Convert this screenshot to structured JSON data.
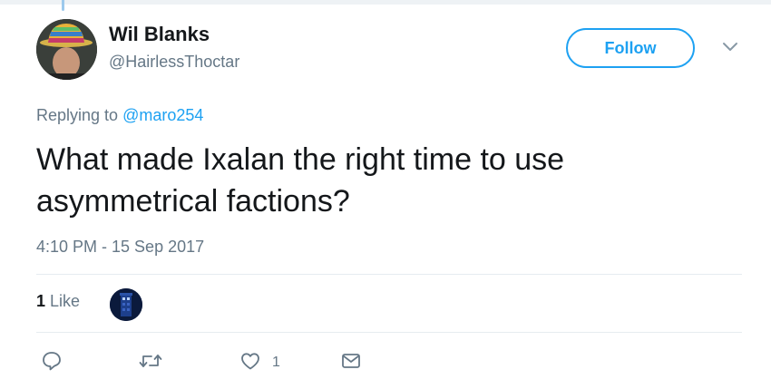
{
  "author": {
    "name": "Wil Blanks",
    "handle": "@HairlessThoctar"
  },
  "follow_label": "Follow",
  "reply_context": {
    "prefix": "Replying to",
    "mention": "@maro254"
  },
  "tweet": {
    "text": "What made Ixalan the right time to use asymmetrical factions?",
    "timestamp": "4:10 PM - 15 Sep 2017"
  },
  "engagement": {
    "like_count": "1",
    "like_label": "Like"
  },
  "actions": {
    "like_count": "1"
  },
  "colors": {
    "accent": "#1da1f2",
    "muted": "#657786",
    "text": "#14171a",
    "divider": "#e6ecf0"
  },
  "icons": [
    "reply-icon",
    "retweet-icon",
    "like-icon",
    "direct-message-icon",
    "chevron-down-icon"
  ]
}
